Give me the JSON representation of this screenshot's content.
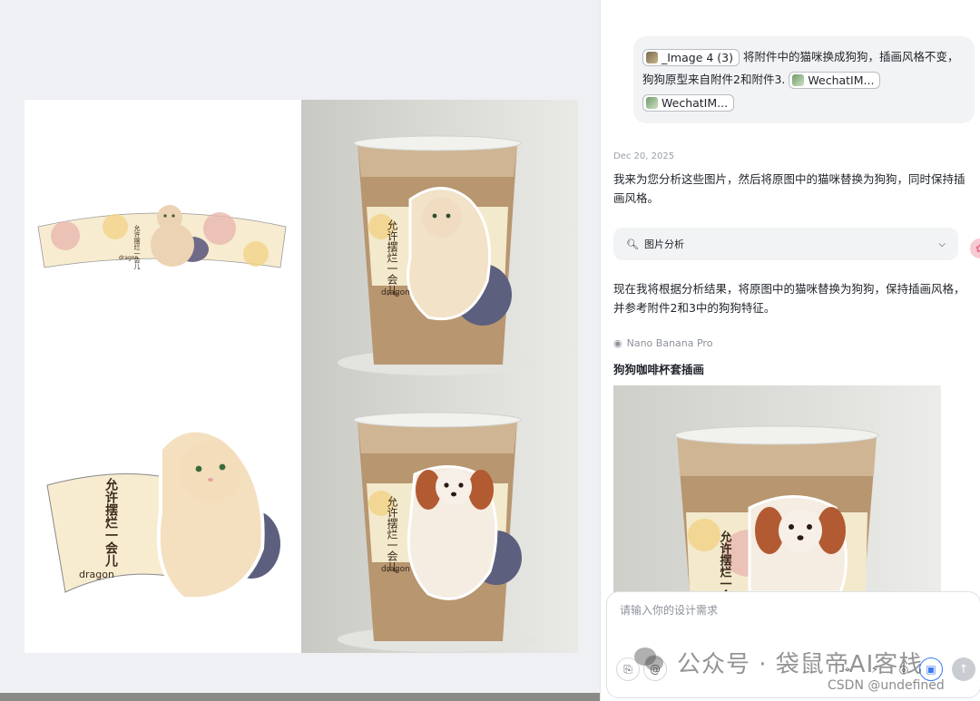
{
  "canvas": {
    "cup_text": "允许摆烂一会儿",
    "brand_text": "dragon",
    "side_text": "dragon"
  },
  "chat": {
    "user_message": {
      "chip1_label": "_Image 4 (3)",
      "text_part1": "将附件中的猫咪换成狗狗，插画风格不变，狗狗原型来自附件2和附件3.",
      "chip2_label": "WechatIM...",
      "chip3_label": "WechatIM..."
    },
    "date": "Dec 20, 2025",
    "reply1": "我来为您分析这些图片，然后将原图中的猫咪替换为狗狗，同时保持插画风格。",
    "analysis_label": "图片分析",
    "reply2": "现在我将根据分析结果，将原图中的猫咪替换为狗狗，保持插画风格，并参考附件2和3中的狗狗特征。",
    "model_name": "Nano Banana Pro",
    "result_title": "狗狗咖啡杯套插画"
  },
  "input": {
    "placeholder": "请输入你的设计需求"
  },
  "watermark": {
    "text": "公众号 · 袋鼠帝AI客栈",
    "csdn": "CSDN @undefined"
  },
  "colors": {
    "panel_bg": "#ffffff",
    "bubble_bg": "#f2f3f5",
    "canvas_bg": "#eef0f3"
  }
}
